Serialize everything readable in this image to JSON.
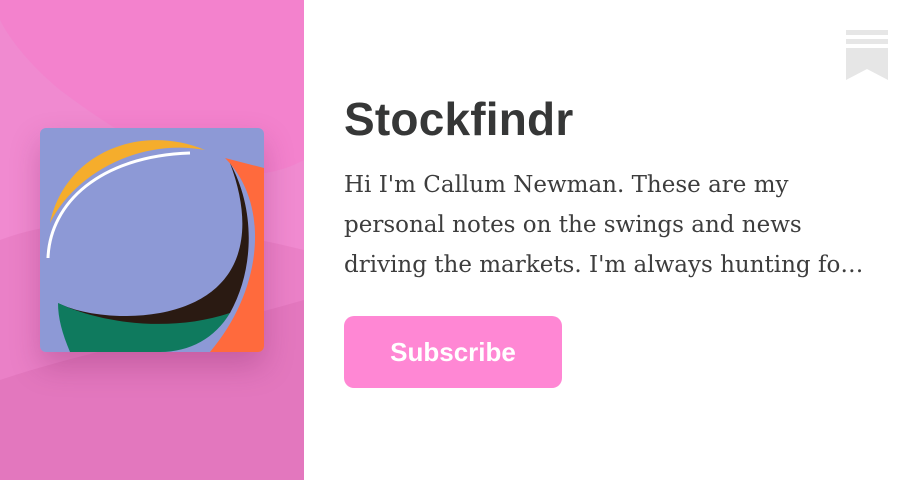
{
  "publication": {
    "name": "Stockfindr",
    "description": "Hi I'm Callum Newman. These are my personal notes on the swings and news driving the markets. I'm always hunting for the next big opportunity."
  },
  "actions": {
    "subscribe_label": "Subscribe",
    "bookmark_icon": "bookmark-icon"
  },
  "colors": {
    "brand_pink": "#ff87d4",
    "panel_pink": "#f08ad0",
    "title_text": "#363737",
    "logo_background": "#8d99d6",
    "logo_yellow": "#f5ad2c",
    "logo_orange": "#ff6a3d",
    "logo_green": "#0f7a5e",
    "logo_dark": "#2a1a12"
  }
}
